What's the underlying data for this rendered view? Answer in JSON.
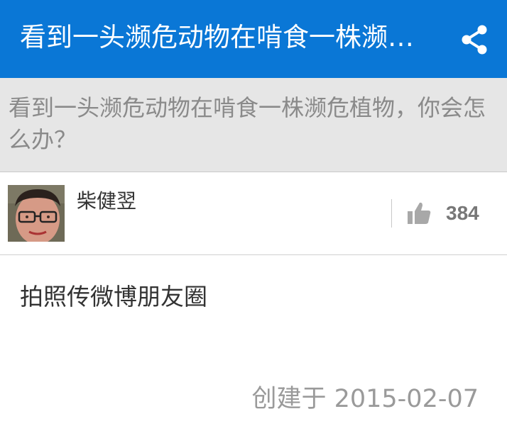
{
  "appbar": {
    "title": "看到一头濒危动物在啃食一株濒危植物，你会怎么办？",
    "share_icon": "share-icon"
  },
  "question": {
    "text": "看到一头濒危动物在啃食一株濒危植物，你会怎么办？"
  },
  "answer": {
    "author": {
      "name": "柴健翌",
      "avatar": "avatar-photo"
    },
    "votes": "384",
    "vote_icon": "thumbs-up-icon",
    "content": "拍照传微博朋友圈",
    "created": "创建于 2015-02-07"
  },
  "colors": {
    "appbar": "#0a77d6",
    "question_band": "#e6e6e6",
    "question_text": "#8a8a8a",
    "muted": "#9a9a9a"
  }
}
